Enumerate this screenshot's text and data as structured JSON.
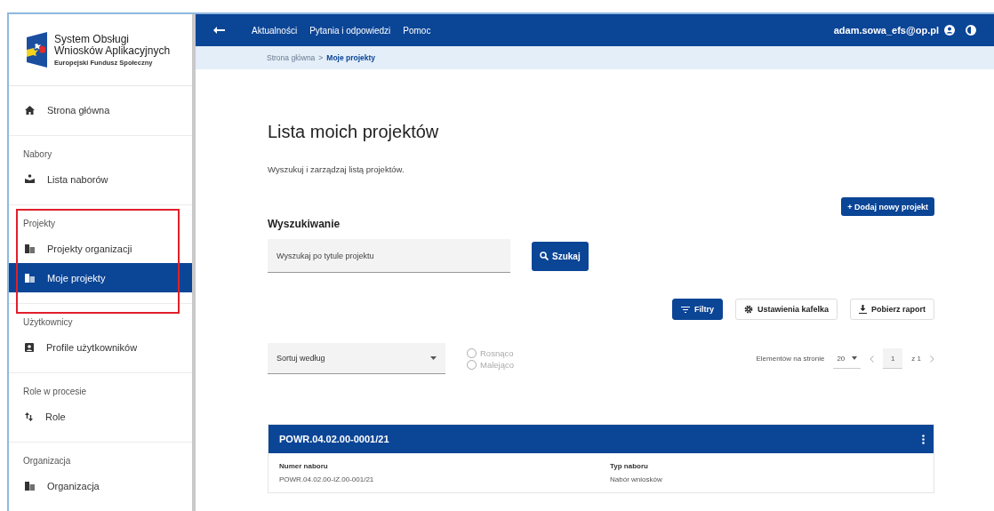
{
  "sidebar": {
    "logo": {
      "title_lines": [
        "System Obsługi",
        "Wniosków Aplikacyjnych"
      ],
      "subtitle": "Europejski Fundusz Społeczny"
    },
    "sections": [
      {
        "items": [
          {
            "label": "Strona główna",
            "selected": false
          }
        ]
      },
      {
        "label": "Nabory",
        "items": [
          {
            "label": "Lista naborów",
            "selected": false
          }
        ]
      },
      {
        "label": "Projekty",
        "highlighted": true,
        "items": [
          {
            "label": "Projekty organizacji",
            "selected": false
          },
          {
            "label": "Moje projekty",
            "selected": true
          }
        ]
      },
      {
        "label": "Użytkownicy",
        "items": [
          {
            "label": "Profile użytkowników",
            "selected": false
          }
        ]
      },
      {
        "label": "Role w procesie",
        "items": [
          {
            "label": "Role",
            "selected": false
          }
        ]
      },
      {
        "label": "Organizacja",
        "items": [
          {
            "label": "Organizacja",
            "selected": false
          }
        ]
      }
    ]
  },
  "topbar": {
    "links": [
      "Aktualności",
      "Pytania i odpowiedzi",
      "Pomoc"
    ],
    "user": "adam.sowa_efs@op.pl"
  },
  "breadcrumb": {
    "separator": ">",
    "items": [
      {
        "label": "Strona główna",
        "current": false
      },
      {
        "label": "Moje projekty",
        "current": true
      }
    ]
  },
  "page": {
    "title": "Lista moich projektów",
    "subtitle": "Wyszukuj i zarządzaj listą projektów.",
    "add_button": "+ Dodaj nowy projekt"
  },
  "search": {
    "heading": "Wyszukiwanie",
    "placeholder": "Wyszukaj po tytule projektu",
    "button": "Szukaj"
  },
  "toolbar": [
    {
      "label": "Filtry",
      "selected": true
    },
    {
      "label": "Ustawienia kafelka",
      "selected": false
    },
    {
      "label": "Pobierz raport",
      "selected": false
    }
  ],
  "sort": {
    "placeholder": "Sortuj według",
    "options": [
      {
        "label": "Rosnąco",
        "selected": false,
        "disabled": true
      },
      {
        "label": "Malejąco",
        "selected": false,
        "disabled": true
      }
    ]
  },
  "pagination": {
    "label": "Elementów na stronie",
    "page_size": "20",
    "page": "1",
    "total": "z 1"
  },
  "card": {
    "title": "POWR.04.02.00-0001/21",
    "fields": [
      {
        "label": "Numer naboru",
        "value": "POWR.04.02.00-IZ.00-001/21"
      },
      {
        "label": "Typ naboru",
        "value": "Nabór wniosków"
      }
    ]
  }
}
